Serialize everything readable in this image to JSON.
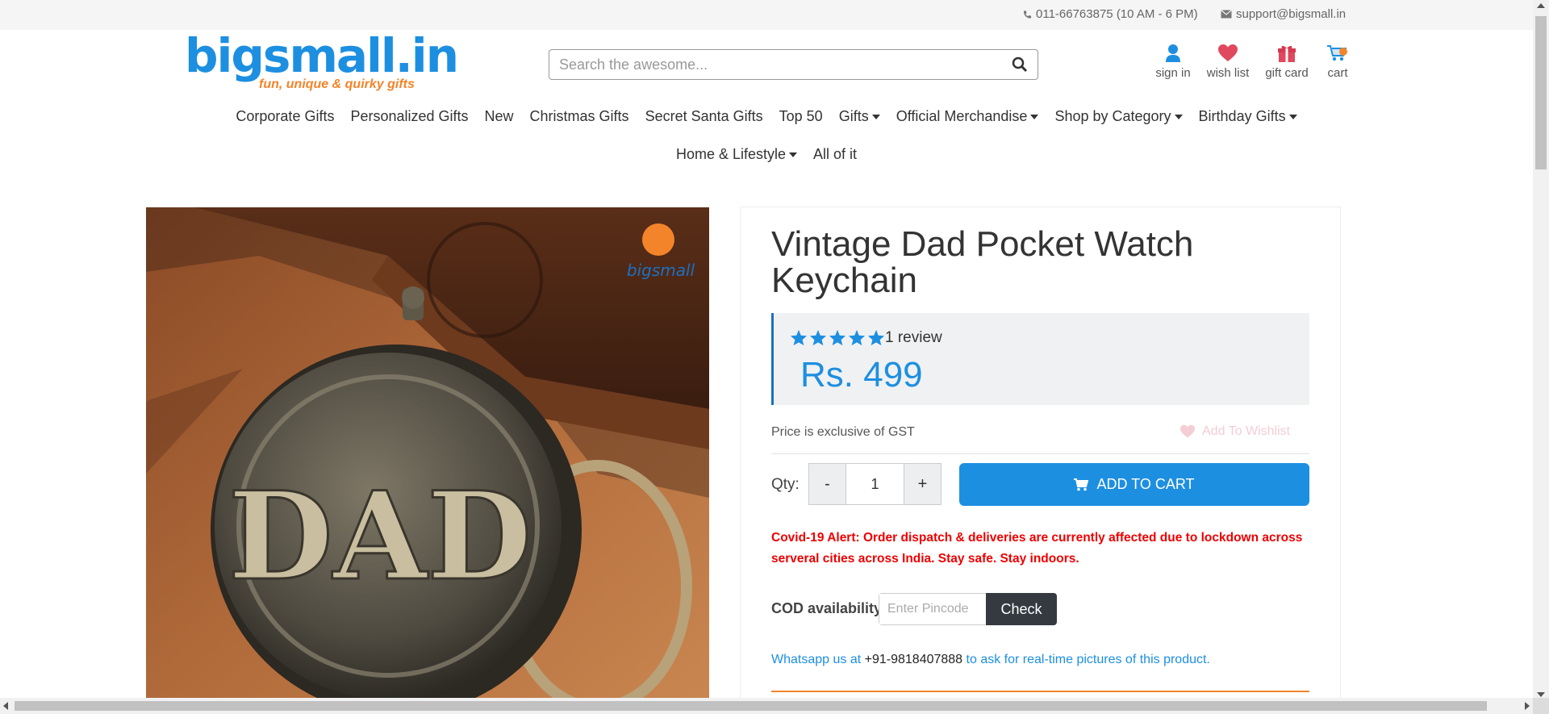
{
  "topbar": {
    "phone": "011-66763875 (10 AM - 6 PM)",
    "email": "support@bigsmall.in",
    "phone_icon": "phone-icon",
    "mail_icon": "mail-icon"
  },
  "header": {
    "logo_text": "bigsmall.in",
    "logo_tagline": "fun, unique & quirky gifts",
    "search_placeholder": "Search the awesome...",
    "icons": [
      {
        "label": "sign in",
        "icon": "user-icon"
      },
      {
        "label": "wish list",
        "icon": "heart-icon"
      },
      {
        "label": "gift card",
        "icon": "gift-icon"
      },
      {
        "label": "cart",
        "icon": "cart-icon"
      }
    ]
  },
  "nav": {
    "row1": [
      {
        "label": "Corporate Gifts",
        "dropdown": false
      },
      {
        "label": "Personalized Gifts",
        "dropdown": false
      },
      {
        "label": "New",
        "dropdown": false
      },
      {
        "label": "Christmas Gifts",
        "dropdown": false
      },
      {
        "label": "Secret Santa Gifts",
        "dropdown": false
      },
      {
        "label": "Top 50",
        "dropdown": false
      },
      {
        "label": "Gifts",
        "dropdown": true
      },
      {
        "label": "Official Merchandise",
        "dropdown": true
      },
      {
        "label": "Shop by Category",
        "dropdown": true
      },
      {
        "label": "Birthday Gifts",
        "dropdown": true
      }
    ],
    "row2": [
      {
        "label": "Home & Lifestyle",
        "dropdown": true
      },
      {
        "label": "All of it",
        "dropdown": false
      }
    ]
  },
  "product": {
    "title": "Vintage Dad Pocket Watch Keychain",
    "rating_stars": 5,
    "reviews": "1 review",
    "price": "Rs. 499",
    "gst_note": "Price is exclusive of GST",
    "wishlist_label": "Add To Wishlist",
    "qty_label": "Qty:",
    "qty_minus": "-",
    "qty_value": "1",
    "qty_plus": "+",
    "add_to_cart": "ADD TO CART",
    "covid_alert": "Covid-19 Alert: Order dispatch & deliveries are currently affected due to lockdown across serveral cities across India. Stay safe. Stay indoors.",
    "cod_label": "COD availability",
    "pincode_placeholder": "Enter Pincode",
    "check_label": "Check",
    "whatsapp_prefix": "Whatsapp us at",
    "whatsapp_number": "+91-9818407888",
    "whatsapp_suffix": "to ask for real-time pictures of this product.",
    "image_watermark": "bigsmall",
    "image_text": "DAD"
  },
  "colors": {
    "brand_blue": "#1d8fe1",
    "brand_orange": "#f4842a",
    "alert_red": "#e00000",
    "heart_red": "#e0485e"
  }
}
